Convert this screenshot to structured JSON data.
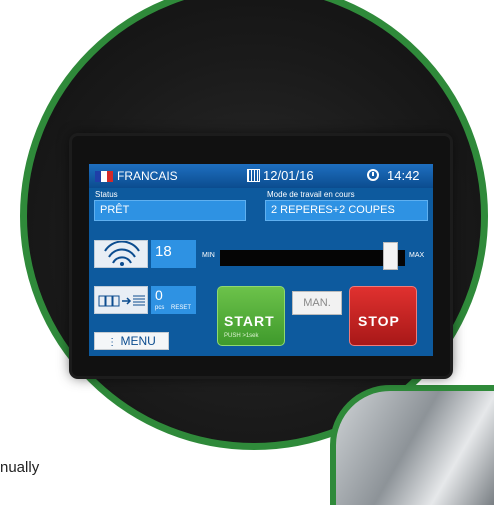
{
  "header": {
    "language": "FRANCAIS",
    "date": "12/01/16",
    "time": "14:42",
    "flag_colors": [
      "#1f3fa8",
      "#ffffff",
      "#d42a2a"
    ]
  },
  "status": {
    "label": "Status",
    "value": "PRÊT"
  },
  "work_mode": {
    "label": "Mode de travail en cours",
    "value": "2 REPERES+2 COUPES"
  },
  "speed": {
    "value": "18",
    "icon": "fan-speed-icon"
  },
  "slider": {
    "min_label": "MIN",
    "max_label": "MAX",
    "level": 0.96
  },
  "counter": {
    "value": "0",
    "unit": "pcs",
    "reset_label": "RESET",
    "icon": "piece-counter-icon"
  },
  "buttons": {
    "start_label": "START",
    "start_sub": "PUSH >1sek",
    "manual_label": "MAN.",
    "stop_label": "STOP",
    "menu_label": "MENU"
  },
  "outside_text": "nually",
  "colors": {
    "ring": "#2f8a3a",
    "screen_bg": "#0d5a9e",
    "start": "#4fae36",
    "stop": "#c62221"
  }
}
